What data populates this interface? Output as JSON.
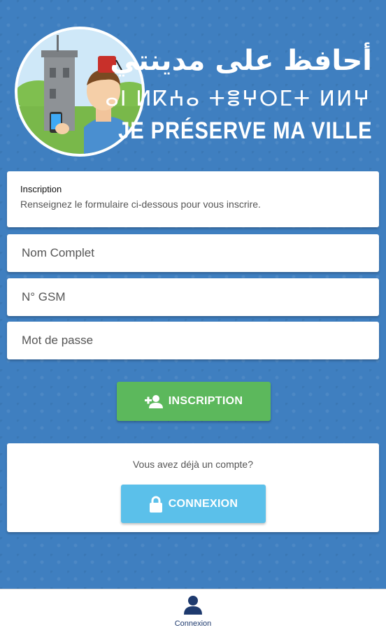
{
  "header": {
    "title_ar": "أحافظ على مدينتي",
    "title_tifinagh": "ⴰⵏ ⵍⴽⵄⴰ ⵜⴻⵖⵔⵎⵜ ⵍⵍⵖ",
    "title_fr": "JE PRÉSERVE MA VILLE",
    "logo_icon": "mascot-logo"
  },
  "intro": {
    "title": "Inscription",
    "text": "Renseignez le formulaire ci-dessous pour vous inscrire."
  },
  "form": {
    "name_placeholder": "Nom Complet",
    "name_value": "",
    "gsm_placeholder": "N° GSM",
    "gsm_value": "",
    "password_placeholder": "Mot de passe",
    "password_value": ""
  },
  "buttons": {
    "inscription_label": "INSCRIPTION",
    "inscription_icon": "add-user-icon",
    "inscription_color": "#5cb85c",
    "connexion_label": "CONNEXION",
    "connexion_icon": "lock-icon",
    "connexion_color": "#5bc0ea"
  },
  "login": {
    "question": "Vous avez déjà un compte?"
  },
  "bottom_nav": {
    "tabs": [
      {
        "label": "Connexion",
        "icon": "user-icon"
      }
    ]
  },
  "colors": {
    "background": "#3f7fc0",
    "card": "#ffffff",
    "nav_icon": "#1e3a6e"
  }
}
